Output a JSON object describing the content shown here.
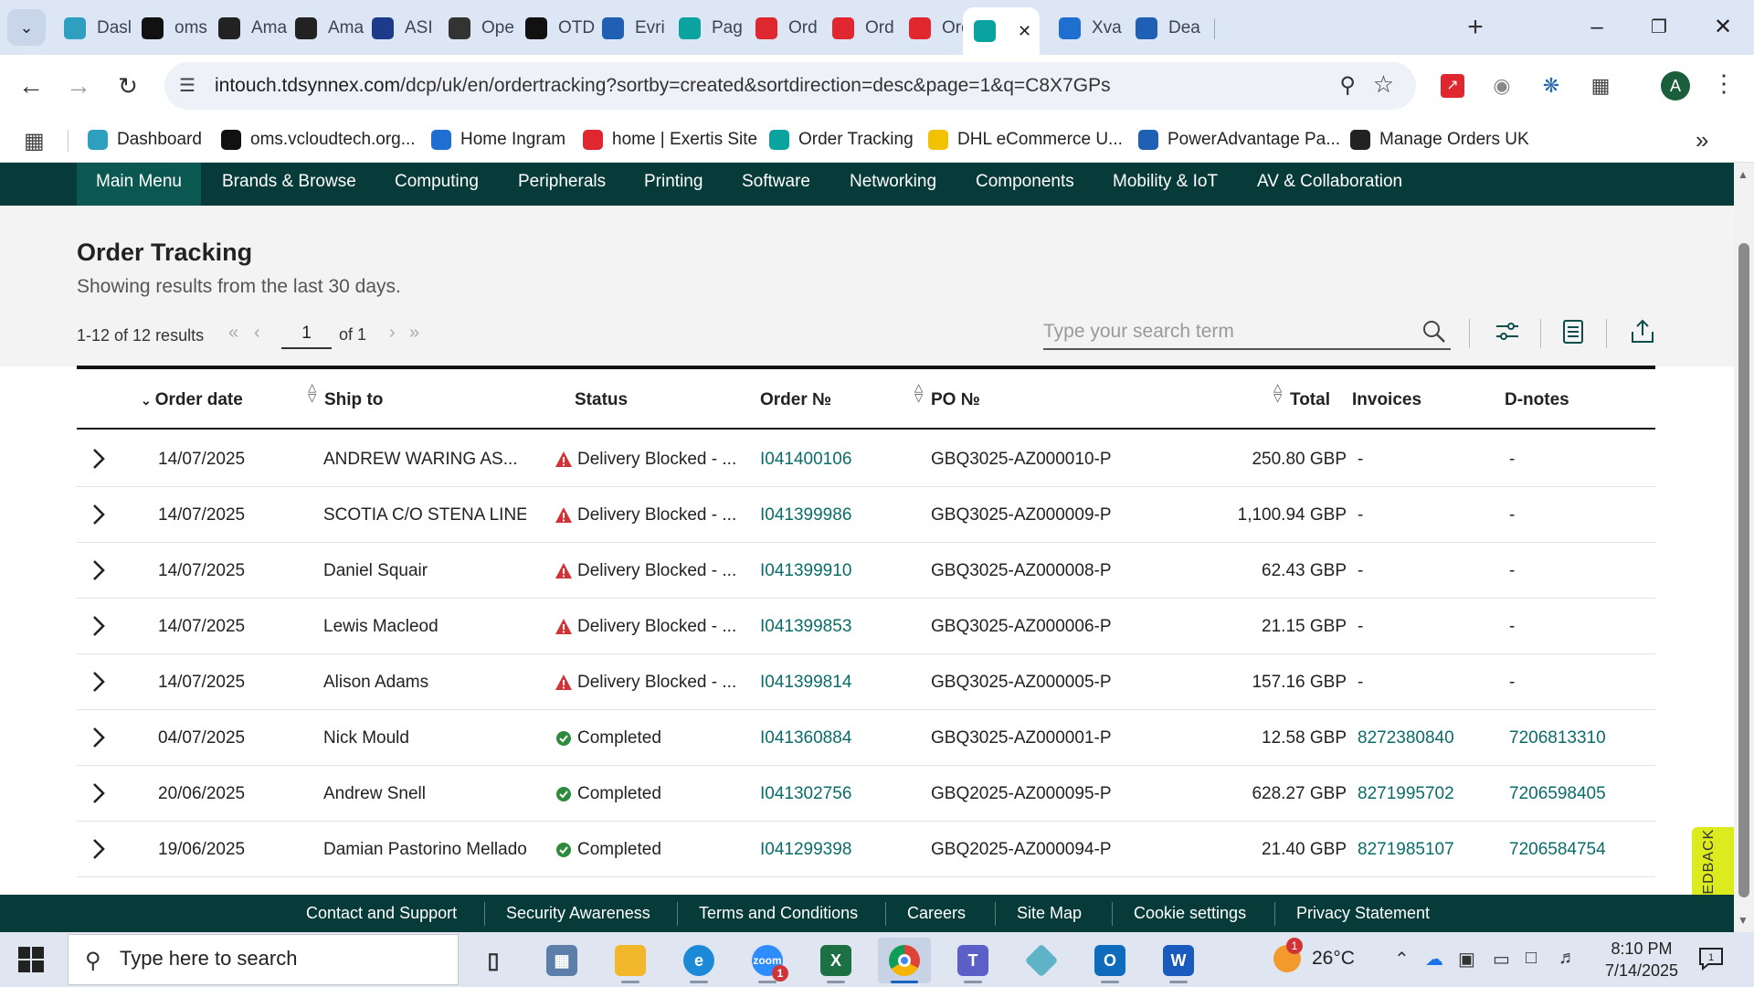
{
  "browser": {
    "tabs": [
      {
        "label": "Dasl",
        "icon": "dashboard-tab-icon",
        "color": "#2f9fc0"
      },
      {
        "label": "oms",
        "icon": "oms-tab-icon",
        "color": "#111111"
      },
      {
        "label": "Ama",
        "icon": "amazon-tab-icon",
        "color": "#222222"
      },
      {
        "label": "Ama",
        "icon": "amazon-tab-icon",
        "color": "#222222"
      },
      {
        "label": "ASI",
        "icon": "asi-tab-icon",
        "color": "#1e3a8a"
      },
      {
        "label": "Ope",
        "icon": "openai-tab-icon",
        "color": "#333333"
      },
      {
        "label": "OTD",
        "icon": "otd-tab-icon",
        "color": "#111111"
      },
      {
        "label": "Evri",
        "icon": "evri-tab-icon",
        "color": "#1f5fb4"
      },
      {
        "label": "Pag",
        "icon": "tdsynnex-tab-icon",
        "color": "#0aa3a0"
      },
      {
        "label": "Ord",
        "icon": "exertis-tab-icon",
        "color": "#e0262e"
      },
      {
        "label": "Ord",
        "icon": "exertis-tab-icon",
        "color": "#e0262e"
      },
      {
        "label": "Ord",
        "icon": "exertis-tab-icon",
        "color": "#e0262e"
      },
      {
        "label": "",
        "icon": "tdsynnex-tab-icon",
        "color": "#0aa3a0",
        "active": true
      },
      {
        "label": "Xva",
        "icon": "xvantage-tab-icon",
        "color": "#1f6fd1"
      },
      {
        "label": "Dea",
        "icon": "deal-tab-icon",
        "color": "#1f5fb4"
      }
    ],
    "url_host": "intouch.tdsynnex.com",
    "url_path": "/dcp/uk/en/ordertracking?sortby=created&sortdirection=desc&page=1&q=C8X7GPs",
    "profile_initial": "A",
    "bookmarks": [
      {
        "label": "Dashboard",
        "color": "#2f9fc0"
      },
      {
        "label": "oms.vcloudtech.org...",
        "color": "#111111"
      },
      {
        "label": "Home Ingram",
        "color": "#1f6fd1"
      },
      {
        "label": "home | Exertis Site",
        "color": "#e0262e"
      },
      {
        "label": "Order Tracking",
        "color": "#0aa3a0"
      },
      {
        "label": "DHL eCommerce U...",
        "color": "#f2c200"
      },
      {
        "label": "PowerAdvantage Pa...",
        "color": "#1f5fb4"
      },
      {
        "label": "Manage Orders UK",
        "color": "#222222"
      }
    ]
  },
  "nav": {
    "items": [
      "Main Menu",
      "Brands & Browse",
      "Computing",
      "Peripherals",
      "Printing",
      "Software",
      "Networking",
      "Components",
      "Mobility & IoT",
      "AV & Collaboration"
    ]
  },
  "page": {
    "title": "Order Tracking",
    "subtitle": "Showing results from the last 30 days.",
    "results_count": "1-12 of 12 results",
    "current_page": "1",
    "page_of": "of 1",
    "search_placeholder": "Type your search term"
  },
  "table": {
    "headers": {
      "order_date": "Order date",
      "ship_to": "Ship to",
      "status": "Status",
      "order_no": "Order №",
      "po_no": "PO №",
      "total": "Total",
      "invoices": "Invoices",
      "dnotes": "D-notes"
    },
    "rows": [
      {
        "date": "14/07/2025",
        "ship_to": "ANDREW WARING AS...",
        "status": "Delivery Blocked - ...",
        "status_type": "blocked",
        "order": "I041400106",
        "po": "GBQ3025-AZ000010-P",
        "total": "250.80 GBP",
        "invoice": "-",
        "dnote": "-"
      },
      {
        "date": "14/07/2025",
        "ship_to": "SCOTIA C/O STENA LINE",
        "status": "Delivery Blocked - ...",
        "status_type": "blocked",
        "order": "I041399986",
        "po": "GBQ3025-AZ000009-P",
        "total": "1,100.94 GBP",
        "invoice": "-",
        "dnote": "-"
      },
      {
        "date": "14/07/2025",
        "ship_to": "Daniel Squair",
        "status": "Delivery Blocked - ...",
        "status_type": "blocked",
        "order": "I041399910",
        "po": "GBQ3025-AZ000008-P",
        "total": "62.43 GBP",
        "invoice": "-",
        "dnote": "-"
      },
      {
        "date": "14/07/2025",
        "ship_to": "Lewis Macleod",
        "status": "Delivery Blocked - ...",
        "status_type": "blocked",
        "order": "I041399853",
        "po": "GBQ3025-AZ000006-P",
        "total": "21.15 GBP",
        "invoice": "-",
        "dnote": "-"
      },
      {
        "date": "14/07/2025",
        "ship_to": "Alison Adams",
        "status": "Delivery Blocked - ...",
        "status_type": "blocked",
        "order": "I041399814",
        "po": "GBQ3025-AZ000005-P",
        "total": "157.16 GBP",
        "invoice": "-",
        "dnote": "-"
      },
      {
        "date": "04/07/2025",
        "ship_to": "Nick Mould",
        "status": "Completed",
        "status_type": "completed",
        "order": "I041360884",
        "po": "GBQ3025-AZ000001-P",
        "total": "12.58 GBP",
        "invoice": "8272380840",
        "dnote": "7206813310"
      },
      {
        "date": "20/06/2025",
        "ship_to": "Andrew Snell",
        "status": "Completed",
        "status_type": "completed",
        "order": "I041302756",
        "po": "GBQ2025-AZ000095-P",
        "total": "628.27 GBP",
        "invoice": "8271995702",
        "dnote": "7206598405"
      },
      {
        "date": "19/06/2025",
        "ship_to": "Damian Pastorino Mellado",
        "status": "Completed",
        "status_type": "completed",
        "order": "I041299398",
        "po": "GBQ2025-AZ000094-P",
        "total": "21.40 GBP",
        "invoice": "8271985107",
        "dnote": "7206584754"
      }
    ]
  },
  "feedback_label": "FEEDBACK",
  "footer": {
    "items": [
      "Contact and Support",
      "Security Awareness",
      "Terms and Conditions",
      "Careers",
      "Site Map",
      "Cookie settings",
      "Privacy Statement"
    ]
  },
  "taskbar": {
    "search_placeholder": "Type here to search",
    "weather_temp": "26°C",
    "weather_badge": "1",
    "time": "8:10 PM",
    "date": "7/14/2025",
    "notification_count": "1",
    "zoom_badge": "1"
  },
  "colors": {
    "nav_bg": "#073b3a",
    "link": "#0a6c6a",
    "blocked": "#d13438",
    "completed": "#2e8b3e",
    "feedback": "#dceb1e"
  }
}
